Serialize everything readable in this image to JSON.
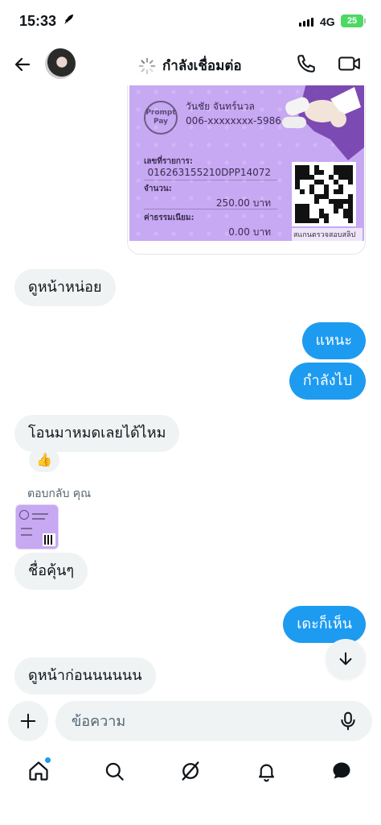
{
  "status_bar": {
    "time": "15:33",
    "network": "4G",
    "battery": "25"
  },
  "header": {
    "title": "กำลังเชื่อมต่อ"
  },
  "slip": {
    "promptpay_label": "Prompt Pay",
    "payee_name": "วันชัย จันทร์นวล",
    "payee_account": "006-xxxxxxxx-5986",
    "ref_label": "เลขที่รายการ:",
    "ref_value": "016263155210DPP14072",
    "amount_label": "จำนวน:",
    "amount_value": "250.00 บาท",
    "fee_label": "ค่าธรรมเนียม:",
    "fee_value": "0.00 บาท",
    "qr_caption": "สแกนตรวจสอบสลิป"
  },
  "messages": [
    {
      "dir": "in",
      "text": "ดูหน้าหน่อย"
    },
    {
      "dir": "out",
      "text": "แหนะ"
    },
    {
      "dir": "out",
      "text": "กำลังไป"
    },
    {
      "dir": "in",
      "text": "โอนมาหมดเลยได้ไหม"
    },
    {
      "dir": "in",
      "text": "ชื่อคุ้นๆ"
    },
    {
      "dir": "out",
      "text": "เดะก็เห็น"
    },
    {
      "dir": "in",
      "text": "ดูหน้าก่อนนนนนน"
    }
  ],
  "reaction": "👍",
  "reply_label": "ตอบกลับ คุณ",
  "composer": {
    "placeholder": "ข้อความ"
  },
  "colors": {
    "accent": "#1d9bf0",
    "bubble_in": "#eff3f4",
    "slip_bg": "#c7a8f2"
  },
  "icons": {
    "back": "arrow-left-icon",
    "call": "phone-icon",
    "video": "video-camera-icon",
    "scroll": "arrow-down-icon",
    "add": "plus-icon",
    "mic": "microphone-icon",
    "nav": [
      "home-icon",
      "search-icon",
      "grok-icon",
      "bell-icon",
      "messages-icon"
    ]
  }
}
